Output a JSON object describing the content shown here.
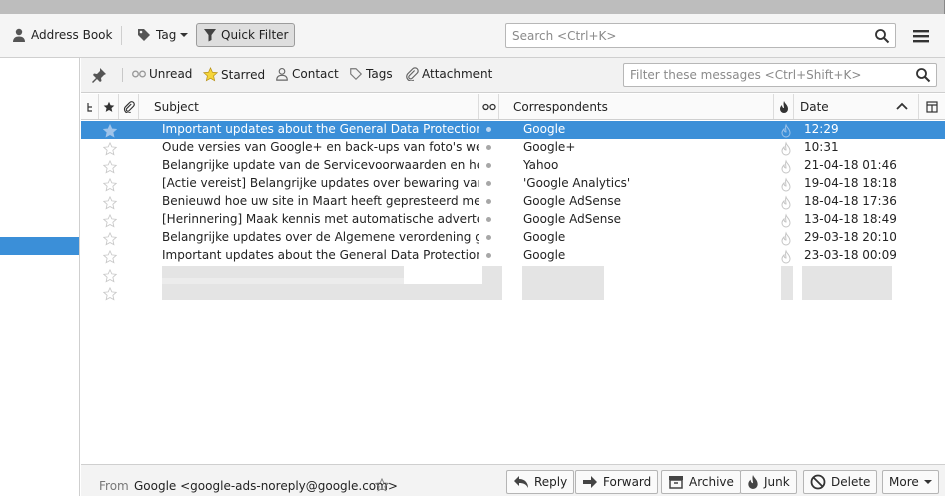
{
  "toolbar": {
    "address_book": "Address Book",
    "tag": "Tag",
    "quick_filter": "Quick Filter",
    "search_placeholder": "Search <Ctrl+K>"
  },
  "quick_filter_bar": {
    "unread": "Unread",
    "starred": "Starred",
    "contact": "Contact",
    "tags": "Tags",
    "attachment": "Attachment",
    "filter_placeholder": "Filter these messages <Ctrl+Shift+K>"
  },
  "columns": {
    "subject": "Subject",
    "correspondents": "Correspondents",
    "date": "Date"
  },
  "messages": [
    {
      "subject": "Important updates about the General Data Protection ...",
      "correspondent": "Google",
      "date": "12:29",
      "selected": true
    },
    {
      "subject": "Oude versies van Google+ en back-ups van foto's werk...",
      "correspondent": "Google+",
      "date": "10:31",
      "selected": false
    },
    {
      "subject": "Belangrijke update van de Servicevoorwaarden en het ...",
      "correspondent": "Yahoo",
      "date": "21-04-18 01:46",
      "selected": false
    },
    {
      "subject": "[Actie vereist] Belangrijke updates over bewaring van ...",
      "correspondent": "'Google Analytics'",
      "date": "19-04-18 18:18",
      "selected": false
    },
    {
      "subject": "Benieuwd hoe uw site in Maart heeft gepresteerd met ...",
      "correspondent": "Google AdSense",
      "date": "18-04-18 17:36",
      "selected": false
    },
    {
      "subject": "[Herinnering] Maak kennis met automatische adverten...",
      "correspondent": "Google AdSense",
      "date": "13-04-18 18:49",
      "selected": false
    },
    {
      "subject": "Belangrijke updates over de Algemene verordening ge...",
      "correspondent": "Google",
      "date": "29-03-18 20:10",
      "selected": false
    },
    {
      "subject": "Important updates about the General Data Protection ...",
      "correspondent": "Google",
      "date": "23-03-18 00:09",
      "selected": false
    }
  ],
  "message_header": {
    "from_label": "From",
    "from_value": "Google <google-ads-noreply@google.com>"
  },
  "actions": {
    "reply": "Reply",
    "forward": "Forward",
    "archive": "Archive",
    "junk": "Junk",
    "delete": "Delete",
    "more": "More"
  },
  "colors": {
    "selection": "#3b8fd8",
    "toolbar_bg": "#f5f5f5"
  }
}
